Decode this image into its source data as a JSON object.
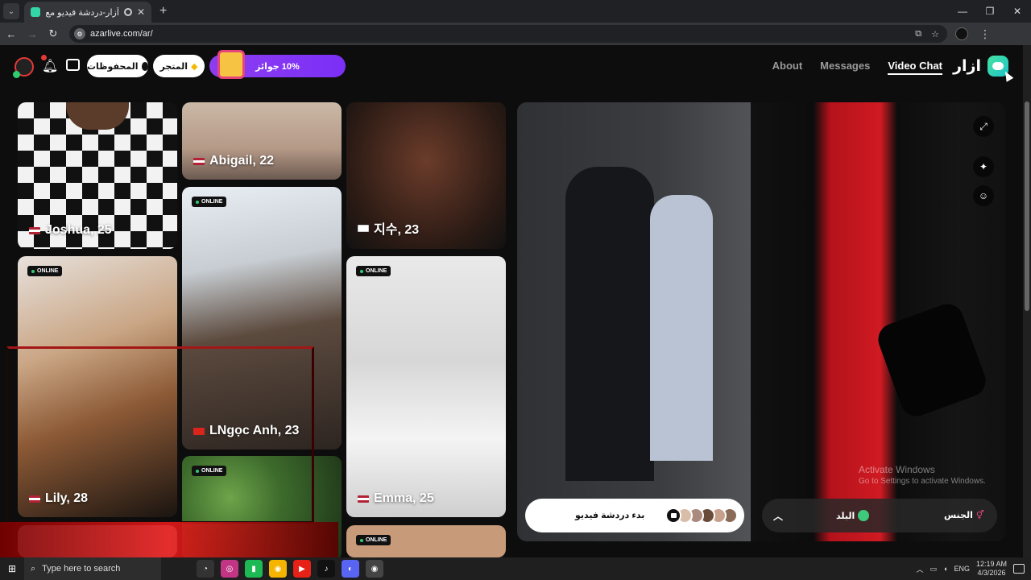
{
  "browser": {
    "tab_title": "أزار-دردشة فيديو مع أشخاص",
    "url": "azarlive.com/ar/",
    "new_tab": "+",
    "min": "—",
    "restore": "❐",
    "close": "✕"
  },
  "header": {
    "saved_label": "المحفوظات",
    "store_label": "المتجر",
    "promo_label": "10% جوائز",
    "nav": [
      {
        "label": "About"
      },
      {
        "label": "Messages"
      },
      {
        "label": "Video Chat"
      }
    ],
    "brand": "ازار",
    "colors": {
      "promo": "#7b2ff7",
      "brand": "#33d6a6"
    }
  },
  "profiles": [
    {
      "name": "Joshua, 25",
      "flag": "us"
    },
    {
      "name": "Abigail, 22",
      "flag": "us"
    },
    {
      "name": "지수, 23",
      "flag": "kr"
    },
    {
      "name": "Lily, 28",
      "flag": "us",
      "status": "ONLINE"
    },
    {
      "name": "LNgọc Anh, 23",
      "flag": "vn",
      "status": "ONLINE"
    },
    {
      "name": "Emma, 25",
      "flag": "us",
      "status": "ONLINE"
    },
    {
      "status": "ONLINE"
    },
    {
      "status": "ONLINE"
    }
  ],
  "video_chat": {
    "start_label": "بدء دردشة فيديو",
    "country_label": "البلد",
    "gender_label": "الجنس"
  },
  "windows": {
    "activate_title": "Activate Windows",
    "activate_sub": "Go to Settings to activate Windows.",
    "search_placeholder": "Type here to search",
    "lang": "ENG",
    "time": "12:19 AM",
    "date": "4/3/2026"
  }
}
